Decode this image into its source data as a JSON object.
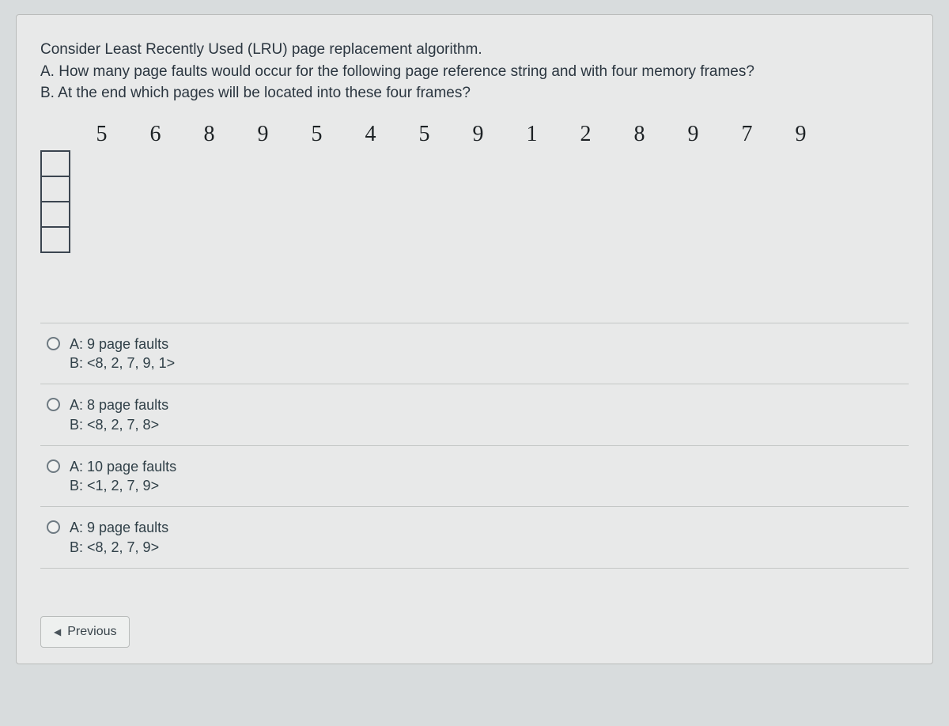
{
  "question": {
    "line1": "Consider Least Recently Used (LRU) page replacement algorithm.",
    "line2": "A. How many page faults would occur for the following page reference string and with four memory frames?",
    "line3": "B. At the end which pages will be located into these four frames?"
  },
  "reference_string": [
    "5",
    "6",
    "8",
    "9",
    "5",
    "4",
    "5",
    "9",
    "1",
    "2",
    "8",
    "9",
    "7",
    "9"
  ],
  "options": [
    {
      "a": "A: 9 page faults",
      "b": "B: <8, 2, 7, 9, 1>"
    },
    {
      "a": "A: 8 page faults",
      "b": "B: <8, 2, 7, 8>"
    },
    {
      "a": "A: 10 page faults",
      "b": "B: <1, 2, 7, 9>"
    },
    {
      "a": "A: 9 page faults",
      "b": "B: <8, 2, 7, 9>"
    }
  ],
  "nav": {
    "previous": "Previous"
  }
}
